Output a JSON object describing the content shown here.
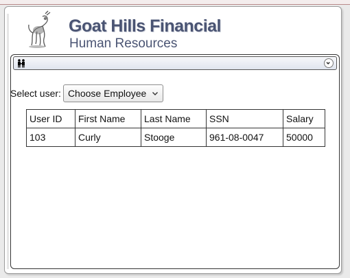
{
  "header": {
    "title": "Goat Hills Financial",
    "subtitle": "Human Resources"
  },
  "toolbar": {
    "icon": "people-icon",
    "toggle_icon": "chevron-circle-icon"
  },
  "user_select": {
    "label": "Select user:",
    "selected": "Choose Employee"
  },
  "table": {
    "headers": [
      "User ID",
      "First Name",
      "Last Name",
      "SSN",
      "Salary"
    ],
    "rows": [
      [
        "103",
        "Curly",
        "Stooge",
        "961-08-0047",
        "50000"
      ]
    ]
  },
  "colors": {
    "brand_text": "#4a5473",
    "panel_bg": "#ffffff",
    "page_bg": "#eaeaea"
  }
}
